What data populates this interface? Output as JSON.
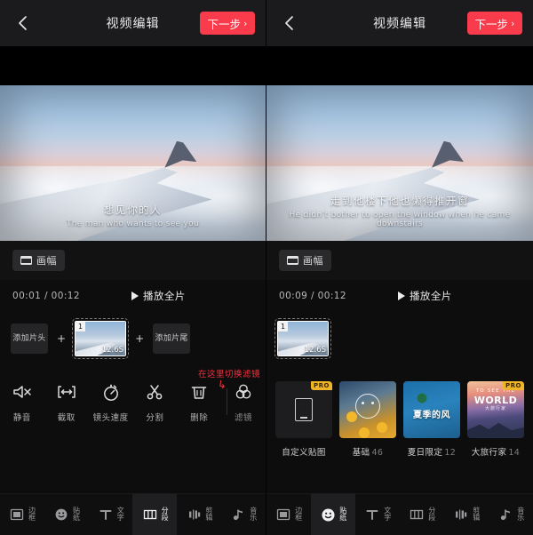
{
  "header": {
    "title": "视频编辑",
    "next_label": "下一步",
    "next_chevron": "›",
    "back_icon": "chevron-left-icon",
    "accent_color": "#fa3b4c"
  },
  "left": {
    "subtitle_cn": "想见你的人",
    "subtitle_en": "The man who wants to see you",
    "ratio_label": "画幅",
    "time_label": "00:01 / 00:12",
    "play_all_label": "播放全片",
    "add_head_label": "添加片头",
    "add_tail_label": "添加片尾",
    "plus": "+",
    "clip": {
      "index": "1",
      "duration": "12.6S"
    },
    "annotation": "在这里切换滤镜",
    "tools": [
      {
        "label": "静音",
        "icon": "mute-icon"
      },
      {
        "label": "截取",
        "icon": "trim-icon"
      },
      {
        "label": "镜头速度",
        "icon": "speed-icon"
      },
      {
        "label": "分割",
        "icon": "split-icon"
      },
      {
        "label": "删除",
        "icon": "trash-icon"
      },
      {
        "label": "滤镜",
        "icon": "filter-icon"
      }
    ],
    "nav": [
      {
        "label": "边框",
        "icon": "frame-icon",
        "active": false
      },
      {
        "label": "贴纸",
        "icon": "sticker-icon",
        "active": false
      },
      {
        "label": "文字",
        "icon": "text-icon",
        "active": false
      },
      {
        "label": "分段",
        "icon": "segment-icon",
        "active": true
      },
      {
        "label": "剪辑",
        "icon": "clip-icon",
        "active": false
      },
      {
        "label": "音乐",
        "icon": "music-icon",
        "active": false
      }
    ]
  },
  "right": {
    "subtitle_cn": "走到他楼下他也懒得推开窗",
    "subtitle_en": "He didn’t bother to open the window when he came downstairs",
    "ratio_label": "画幅",
    "time_label": "00:09 / 00:12",
    "play_all_label": "播放全片",
    "clip": {
      "index": "1",
      "duration": "12.6S"
    },
    "stickers": [
      {
        "caption": "自定义贴图",
        "count": "",
        "pro": "PRO",
        "kind": "custom"
      },
      {
        "caption": "基础",
        "count": "46",
        "pro": "",
        "kind": "basic"
      },
      {
        "caption": "夏日限定",
        "count": "12",
        "pro": "",
        "kind": "summer",
        "art_text": "夏季的风"
      },
      {
        "caption": "大旅行家",
        "count": "14",
        "pro": "PRO",
        "kind": "travel",
        "art_line1": "TO SEE THE",
        "art_line2": "WORLD",
        "art_line3": "大旅行家"
      }
    ],
    "nav": [
      {
        "label": "边框",
        "icon": "frame-icon",
        "active": false
      },
      {
        "label": "贴纸",
        "icon": "sticker-icon",
        "active": true
      },
      {
        "label": "文字",
        "icon": "text-icon",
        "active": false
      },
      {
        "label": "分段",
        "icon": "segment-icon",
        "active": false
      },
      {
        "label": "剪辑",
        "icon": "clip-icon",
        "active": false
      },
      {
        "label": "音乐",
        "icon": "music-icon",
        "active": false
      }
    ]
  }
}
